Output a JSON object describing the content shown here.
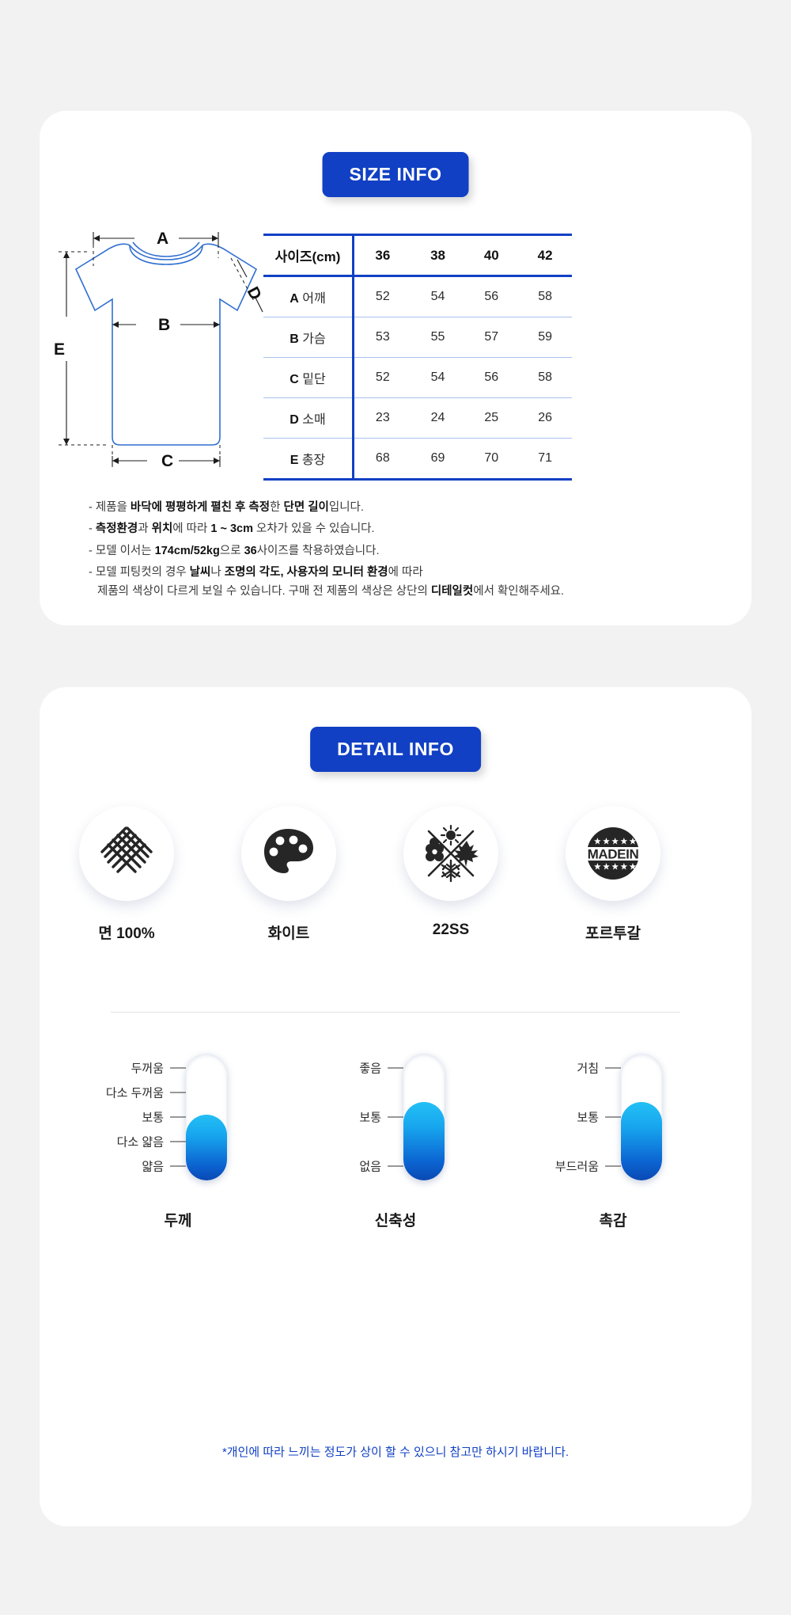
{
  "size_section": {
    "badge": "SIZE INFO",
    "diagram": {
      "labels": [
        "A",
        "B",
        "C",
        "D",
        "E"
      ]
    },
    "table": {
      "columns": [
        "사이즈(cm)",
        "36",
        "38",
        "40",
        "42"
      ],
      "rows": [
        {
          "code": "A",
          "name": "어깨",
          "values": [
            "52",
            "54",
            "56",
            "58"
          ]
        },
        {
          "code": "B",
          "name": "가슴",
          "values": [
            "53",
            "55",
            "57",
            "59"
          ]
        },
        {
          "code": "C",
          "name": "밑단",
          "values": [
            "52",
            "54",
            "56",
            "58"
          ]
        },
        {
          "code": "D",
          "name": "소매",
          "values": [
            "23",
            "24",
            "25",
            "26"
          ]
        },
        {
          "code": "E",
          "name": "총장",
          "values": [
            "68",
            "69",
            "70",
            "71"
          ]
        }
      ]
    },
    "notes": [
      {
        "parts": [
          {
            "t": "- 제품을 ",
            "b": false
          },
          {
            "t": "바닥에 평평하게 펼친 후 측정",
            "b": true
          },
          {
            "t": "한 ",
            "b": false
          },
          {
            "t": "단면 길이",
            "b": true
          },
          {
            "t": "입니다.",
            "b": false
          }
        ]
      },
      {
        "parts": [
          {
            "t": "- ",
            "b": false
          },
          {
            "t": "측정환경",
            "b": true
          },
          {
            "t": "과 ",
            "b": false
          },
          {
            "t": "위치",
            "b": true
          },
          {
            "t": "에 따라 ",
            "b": false
          },
          {
            "t": "1 ~ 3cm",
            "b": true
          },
          {
            "t": " 오차가 있을 수 있습니다.",
            "b": false
          }
        ]
      },
      {
        "parts": [
          {
            "t": "- 모델 이서는 ",
            "b": false
          },
          {
            "t": "174cm/52kg",
            "b": true
          },
          {
            "t": "으로 ",
            "b": false
          },
          {
            "t": "36",
            "b": true
          },
          {
            "t": "사이즈를 착용하였습니다.",
            "b": false
          }
        ]
      },
      {
        "parts": [
          {
            "t": "- 모델 피팅컷의 경우 ",
            "b": false
          },
          {
            "t": "날씨",
            "b": true
          },
          {
            "t": "나 ",
            "b": false
          },
          {
            "t": "조명의 각도, 사용자의 모니터 환경",
            "b": true
          },
          {
            "t": "에 따라",
            "b": false
          }
        ],
        "parts2": [
          {
            "t": "제품의 색상이 다르게 보일 수 있습니다. 구매 전 제품의 색상은 상단의 ",
            "b": false
          },
          {
            "t": "디테일컷",
            "b": true
          },
          {
            "t": "에서 확인해주세요.",
            "b": false
          }
        ]
      }
    ]
  },
  "detail_section": {
    "badge": "DETAIL INFO",
    "icons": [
      {
        "icon": "woven-fabric-icon",
        "label": "면 100%"
      },
      {
        "icon": "paint-palette-icon",
        "label": "화이트"
      },
      {
        "icon": "four-seasons-icon",
        "label": "22SS"
      },
      {
        "icon": "made-in-badge-icon",
        "label": "포르투갈"
      }
    ],
    "made_in_text": "MADEIN",
    "gauges": [
      {
        "title": "두께",
        "levels": [
          "두꺼움",
          "다소 두꺼움",
          "보통",
          "다소 얇음",
          "얇음"
        ],
        "fill_percent": 52
      },
      {
        "title": "신축성",
        "levels": [
          "좋음",
          "보통",
          "없음"
        ],
        "fill_percent": 62
      },
      {
        "title": "촉감",
        "levels": [
          "거침",
          "보통",
          "부드러움"
        ],
        "fill_percent": 62
      }
    ],
    "footnote": "*개인에 따라 느끼는 정도가 상이 할 수 있으니 참고만 하시기 바랍니다."
  },
  "colors": {
    "brand_blue": "#1140c4",
    "table_line": "#1140c4",
    "diagram_blue": "#2f6fd0",
    "gauge_light": "#23c0f5",
    "gauge_dark": "#0a49b4",
    "background": "#f2f2f2"
  }
}
